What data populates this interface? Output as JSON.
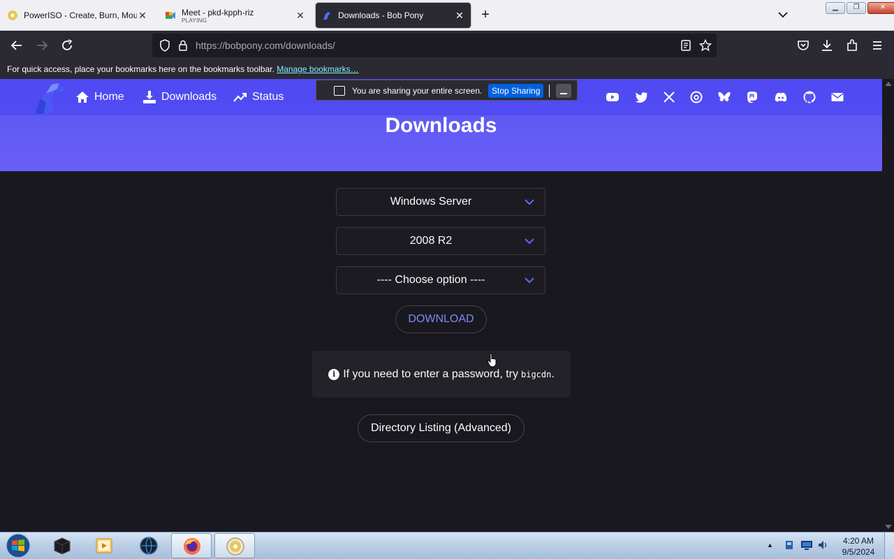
{
  "browser": {
    "tabs": [
      {
        "title": "PowerISO - Create, Burn, Mount",
        "subtitle": ""
      },
      {
        "title": "Meet - pkd-kpph-riz",
        "subtitle": "PLAYING"
      },
      {
        "title": "Downloads - Bob Pony",
        "subtitle": ""
      }
    ],
    "url_host": "https://bobpony.com",
    "url_path": "/downloads/",
    "bookmarks_hint": "For quick access, place your bookmarks here on the bookmarks toolbar.",
    "bookmarks_link": "Manage bookmarks…"
  },
  "share_bar": {
    "message": "You are sharing your entire screen.",
    "stop_label": "Stop Sharing"
  },
  "site": {
    "nav": {
      "home": "Home",
      "downloads": "Downloads",
      "status": "Status"
    },
    "social_icons": [
      "youtube-icon",
      "twitter-icon",
      "x-icon",
      "threads-icon",
      "bluesky-icon",
      "mastodon-icon",
      "discord-icon",
      "github-icon",
      "mail-icon"
    ],
    "accent_color": "#5a52f3",
    "page_title": "Downloads"
  },
  "form": {
    "os_select": "Windows Server",
    "version_select": "2008 R2",
    "option_select": "---- Choose option ----",
    "download_label": "DOWNLOAD",
    "notice_text": "If you need to enter a password, try",
    "notice_code": "bigcdn",
    "notice_end": ".",
    "directory_label": "Directory Listing (Advanced)"
  },
  "taskbar": {
    "time": "4:20 AM",
    "date": "9/5/2024"
  }
}
